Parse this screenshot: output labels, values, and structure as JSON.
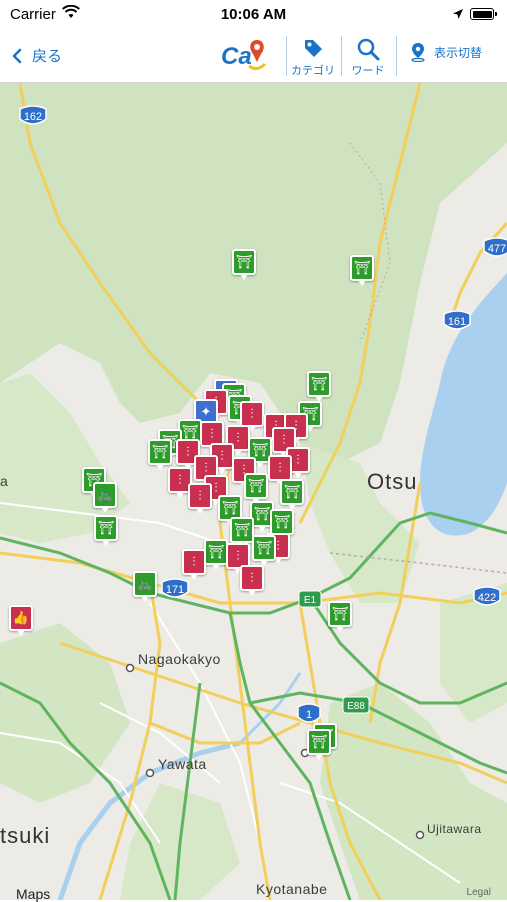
{
  "status_bar": {
    "carrier": "Carrier",
    "time": "10:06 AM"
  },
  "nav": {
    "back_label": "戻る",
    "category_label": "カテゴリ",
    "word_label": "ワード",
    "switch_label": "表示切替",
    "logo_text": "Ca"
  },
  "map": {
    "cities": {
      "otsu": "Otsu",
      "nagaokakyo": "Nagaokakyo",
      "yawata": "Yawata",
      "ujitawara": "Ujitawara",
      "kyotanabe": "Kyotanabe",
      "tsuki": "tsuki",
      "edge_a": "a"
    },
    "road_badges": {
      "r162": "162",
      "r477": "477",
      "r161": "161",
      "r171": "171",
      "r422": "422",
      "r1": "1",
      "e1": "E1",
      "e88": "E88"
    },
    "attribution": "Maps",
    "legal": "Legal"
  },
  "colors": {
    "accent": "#1a73c9",
    "pin_green": "#2f9b2c",
    "pin_red": "#c93050",
    "pin_blue": "#3f6fd0",
    "forest": "#cfe3c0",
    "land": "#ecebe6",
    "water": "#a9d1ef"
  }
}
